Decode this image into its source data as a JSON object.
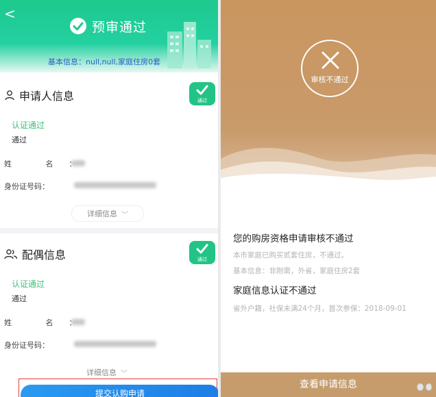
{
  "left": {
    "back_glyph": "<",
    "title": "预审通过",
    "header_info": "基本信息：null,null,家庭住房0套",
    "applicant": {
      "title": "申请人信息",
      "badge": "通过",
      "auth_status": "认证通过",
      "auth_result": "通过",
      "name_label": "姓  名：",
      "id_label": "身份证号码：",
      "detail_label": "详细信息"
    },
    "spouse": {
      "title": "配偶信息",
      "badge": "通过",
      "auth_status": "认证通过",
      "auth_result": "通过",
      "name_label": "姓  名：",
      "id_label": "身份证号码：",
      "detail_label": "详细信息"
    },
    "bottom_button": "提交认购申请"
  },
  "right": {
    "status_badge": "审核不通过",
    "main_title": "您的购房资格申请审核不通过",
    "sub1": "本市家庭已购买贰套住房，不通过。",
    "sub2": "基本信息：非刚需，外省，家庭住房2套",
    "family_title": "家庭信息认证不通过",
    "family_sub": "省外户籍，社保未满24个月，首次参保：2018-09-01",
    "view_button": "查看申请信息"
  },
  "colors": {
    "green": "#22c486",
    "gold": "#c69c6d",
    "blue": "#2c5fc7"
  }
}
